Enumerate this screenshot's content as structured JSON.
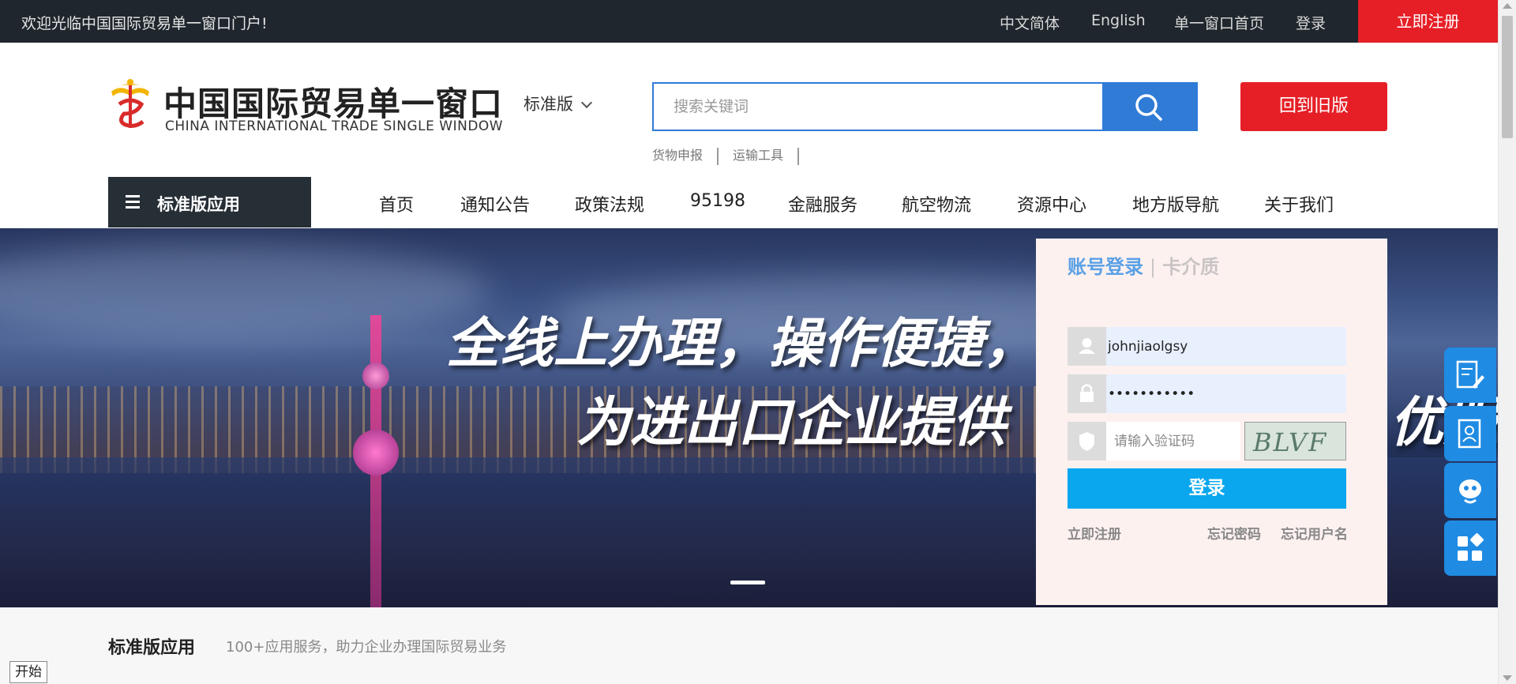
{
  "topbar": {
    "welcome": "欢迎光临中国国际贸易单一窗口门户!",
    "links": [
      "中文简体",
      "English",
      "单一窗口首页",
      "登录"
    ],
    "register": "立即注册"
  },
  "header": {
    "logo_cn": "中国国际贸易单一窗口",
    "logo_en": "CHINA INTERNATIONAL TRADE SINGLE WINDOW",
    "edition": "标准版",
    "search_placeholder": "搜索关键词",
    "hotwords": [
      "货物申报",
      "运输工具"
    ],
    "old_version": "回到旧版"
  },
  "nav": {
    "app_button": "标准版应用",
    "items": [
      "首页",
      "通知公告",
      "政策法规",
      "95198",
      "金融服务",
      "航空物流",
      "资源中心",
      "地方版导航",
      "关于我们"
    ]
  },
  "banner": {
    "line1": "全线上办理，操作便捷，",
    "line2": "为进出口企业提供",
    "line3": "优服务"
  },
  "login": {
    "tab_account": "账号登录",
    "tab_card": "卡介质",
    "username": "johnjiaolgsy",
    "password": "•••••••••••",
    "captcha_placeholder": "请输入验证码",
    "captcha_text": "BLVF",
    "submit": "登录",
    "register": "立即注册",
    "forgot_password": "忘记密码",
    "forgot_username": "忘记用户名"
  },
  "section": {
    "title": "标准版应用",
    "subtitle": "100+应用服务，助力企业办理国际贸易业务"
  },
  "taskbar": {
    "start": "开始"
  },
  "colors": {
    "topbar_bg": "#1f262d",
    "brand_red": "#e61f27",
    "search_blue": "#2f7bd6",
    "login_blue": "#0aa7ef",
    "float_blue": "#1f8be3"
  }
}
